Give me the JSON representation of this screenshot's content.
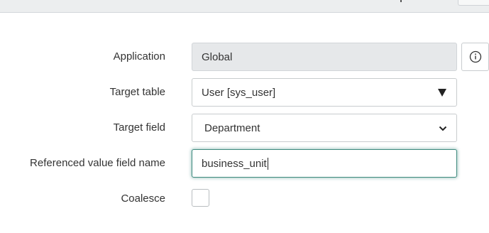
{
  "form": {
    "application": {
      "label": "Application",
      "value": "Global"
    },
    "target_table": {
      "label": "Target table",
      "value": "User [sys_user]"
    },
    "target_field": {
      "label": "Target field",
      "value": "Department"
    },
    "referenced_value_field_name": {
      "label": "Referenced value field name",
      "value": "business_unit"
    },
    "coalesce": {
      "label": "Coalesce",
      "checked": false
    }
  },
  "icons": {
    "info": "info-icon",
    "select_arrow": "triangle-down-icon",
    "chevron": "chevron-down-icon"
  },
  "colors": {
    "focus_ring": "#3d8a7e",
    "readonly_bg": "#e6e8ea",
    "top_bar_bg": "#eceeef"
  }
}
